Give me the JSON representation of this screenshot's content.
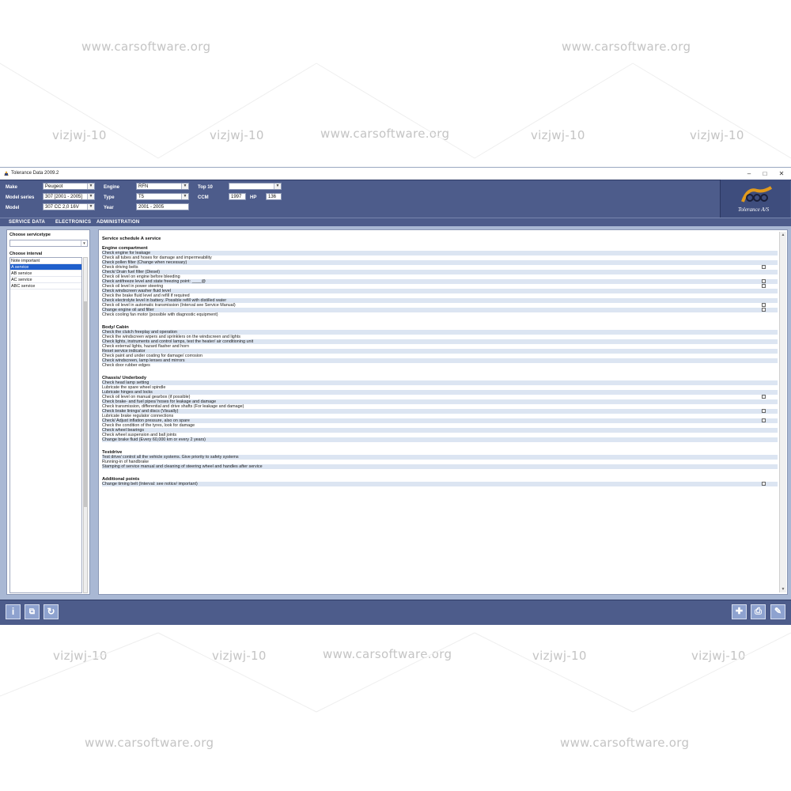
{
  "watermarks": {
    "site": "www.carsoftware.org",
    "code": "vizjwj-10"
  },
  "window": {
    "title": "Tolerance Data 2009.2",
    "minimize": "–",
    "maximize": "□",
    "close": "✕"
  },
  "header": {
    "make_label": "Make",
    "make_value": "Peugeot",
    "series_label": "Model series",
    "series_value": "307 [2001 - 2005]",
    "model_label": "Model",
    "model_value": "307 CC 2,0 16V",
    "engine_label": "Engine",
    "engine_value": "RFN",
    "type_label": "Type",
    "type_value": "T5",
    "year_label": "Year",
    "year_value": "2001 - 2005",
    "top10_label": "Top 10",
    "top10_value": "",
    "ccm_label": "CCM",
    "ccm_value": "1997",
    "hp_label": "HP",
    "hp_value": "136",
    "logo_text": "Tolerance A/S"
  },
  "nav": [
    "SERVICE DATA",
    "ELECTRONICS",
    "ADMINISTRATION"
  ],
  "left": {
    "servicetype_label": "Choose servicetype",
    "interval_label": "Choose interval",
    "intervals": [
      {
        "label": "Note important",
        "selected": false
      },
      {
        "label": "A service",
        "selected": true
      },
      {
        "label": "AB service",
        "selected": false
      },
      {
        "label": "AC service",
        "selected": false
      },
      {
        "label": "ABC service",
        "selected": false
      }
    ]
  },
  "main": {
    "title": "Service schedule A service",
    "sections": [
      {
        "name": "Engine compartment",
        "items": [
          {
            "t": "Check engine for leakage"
          },
          {
            "t": "Check all tubes and hoses for damage and impermeability"
          },
          {
            "t": "Check pollen filter (Change when necessary)"
          },
          {
            "t": "Check driving belts",
            "doc": true
          },
          {
            "t": "Check/ Drain fuel filter (Diesel)"
          },
          {
            "t": "Check oil level on engine before bleeding"
          },
          {
            "t": "Check antifreeze level and state freezing point: ____@",
            "doc": true
          },
          {
            "t": "Check oil level in power steering",
            "doc": true
          },
          {
            "t": "Check windscreen washer fluid level"
          },
          {
            "t": "Check the brake fluid level and refill if required"
          },
          {
            "t": "Check electrolyte level in battery. Possible refill with distilled water"
          },
          {
            "t": "Check oil level in automatic transmission (Interval see Service Manual)",
            "doc": true
          },
          {
            "t": "Change engine oil and filter",
            "doc": true
          },
          {
            "t": "Check cooling fan motor (possible with diagnostic equipment)"
          }
        ]
      },
      {
        "name": "Body/ Cabin",
        "items": [
          {
            "t": "Check the clutch freeplay and operation"
          },
          {
            "t": "Check the windscreen wipers and sprinklers on the windscreen and lights"
          },
          {
            "t": "Check lights, instruments and control lamps, test the heater/ air conditioning unit"
          },
          {
            "t": "Check external lights, hazard flasher and horn"
          },
          {
            "t": "Reset service indicator"
          },
          {
            "t": "Check paint and under coating for damage/ corrosion"
          },
          {
            "t": "Check windscreen, lamp lenses and mirrors"
          },
          {
            "t": "Check door rubber edges"
          }
        ]
      },
      {
        "name": "Chassis/ Underbody",
        "items": [
          {
            "t": "Check head lamp setting"
          },
          {
            "t": "Lubricate the spare wheel spindle"
          },
          {
            "t": "Lubricate hinges and locks"
          },
          {
            "t": "Check oil level on manual gearbox (if possible)",
            "doc": true
          },
          {
            "t": "Check brake- and fuel pipes/ hoses for leakage and damage"
          },
          {
            "t": "Check transmission, differential and drive shafts (For leakage and damage)"
          },
          {
            "t": "Check brake linings/ and discs (Visually)",
            "doc": true
          },
          {
            "t": "Lubricate brake regulator connections"
          },
          {
            "t": "Check/ Adjust inflation pressure, also on spare",
            "doc": true
          },
          {
            "t": "Check the condition of the tyres, look for damage"
          },
          {
            "t": "Check wheel bearings"
          },
          {
            "t": "Check wheel suspension and ball joints"
          },
          {
            "t": "Change brake fluid (Every 60,000 km or every 2 years)"
          }
        ]
      },
      {
        "name": "Testdrive",
        "items": [
          {
            "t": "Test drive/ control all the vehicle systems. Give priority to safety systems"
          },
          {
            "t": "Running-in of handbrake"
          },
          {
            "t": "Stamping of service manual and cleaning of steering wheel and handles after service"
          }
        ]
      },
      {
        "name": "Additional points",
        "items": [
          {
            "t": "Change timing belt (Interval: see notice/ important)",
            "doc": true
          }
        ]
      }
    ]
  },
  "toolbar": {
    "info": "i",
    "print": "⧉",
    "refresh": "↻",
    "move": "✚",
    "printer": "⎙",
    "edit": "✎"
  }
}
